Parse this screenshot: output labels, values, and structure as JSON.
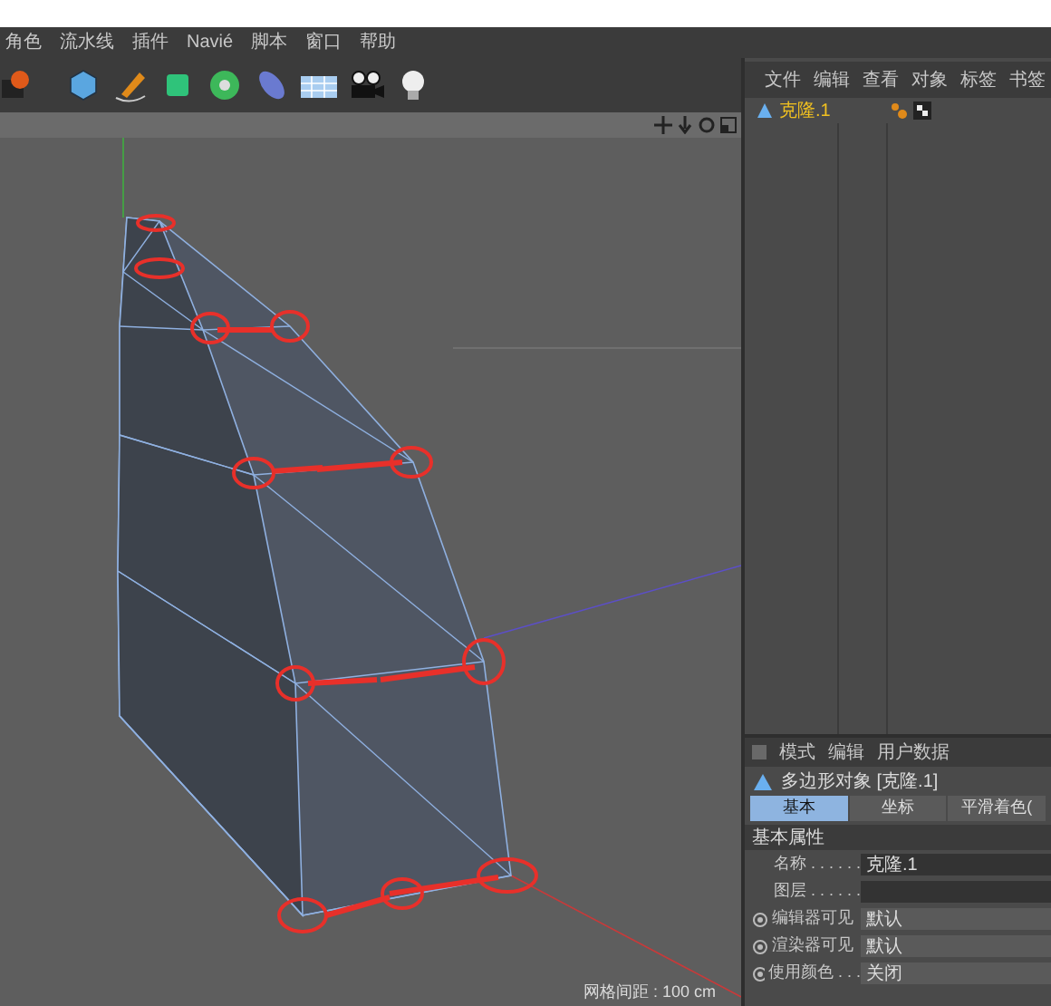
{
  "menu_bar": [
    "角色",
    "流水线",
    "插件",
    "Navié",
    "脚本",
    "窗口",
    "帮助"
  ],
  "viewport": {
    "status": "网格间距 : 100 cm"
  },
  "object_manager": {
    "menu": [
      "文件",
      "编辑",
      "查看",
      "对象",
      "标签",
      "书签"
    ],
    "objects": [
      {
        "name": "克隆.1",
        "selected": true
      }
    ]
  },
  "attribute_manager": {
    "menu": [
      "模式",
      "编辑",
      "用户数据"
    ],
    "object_title": "多边形对象 [克隆.1]",
    "tabs": [
      {
        "label": "基本",
        "selected": true
      },
      {
        "label": "坐标",
        "selected": false
      },
      {
        "label": "平滑着色(",
        "selected": false
      }
    ],
    "section": "基本属性",
    "fields": [
      {
        "kind": "text",
        "label": "名称 . . . . . .",
        "value": "克隆.1"
      },
      {
        "kind": "text",
        "label": "图层 . . . . . ."
      },
      {
        "kind": "select",
        "label": "编辑器可见",
        "value": "默认"
      },
      {
        "kind": "select",
        "label": "渲染器可见",
        "value": "默认"
      },
      {
        "kind": "select",
        "label": "使用颜色 . . .",
        "value": "关闭"
      }
    ]
  }
}
